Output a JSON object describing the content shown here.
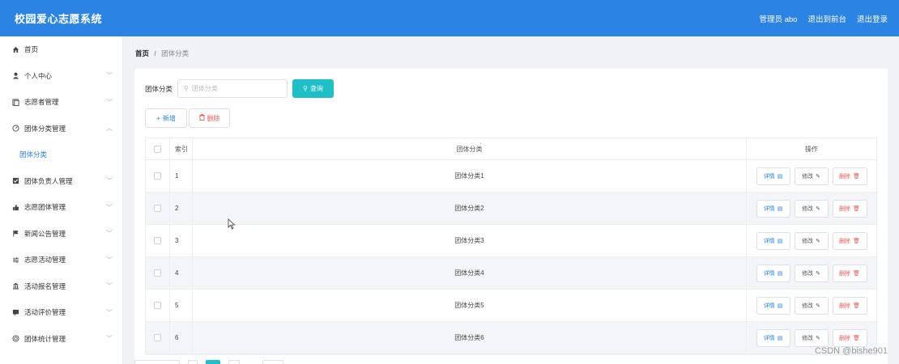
{
  "header": {
    "app_title": "校园爱心志愿系统",
    "admin_label": "管理员 abo",
    "back_to_front": "退出到前台",
    "logout": "退出登录"
  },
  "sidebar": {
    "items": [
      {
        "label": "首页",
        "icon": "home-icon",
        "chevron": false
      },
      {
        "label": "个人中心",
        "icon": "user-icon",
        "chevron": true
      },
      {
        "label": "志愿者管理",
        "icon": "document-icon",
        "chevron": true
      },
      {
        "label": "团体分类管理",
        "icon": "gauge-icon",
        "chevron": true,
        "expanded": true
      },
      {
        "label": "团体负责人管理",
        "icon": "checkbox-icon",
        "chevron": true
      },
      {
        "label": "志愿团体管理",
        "icon": "thumbs-up-icon",
        "chevron": true
      },
      {
        "label": "新闻公告管理",
        "icon": "flag-icon",
        "chevron": true
      },
      {
        "label": "志愿活动管理",
        "icon": "sliders-icon",
        "chevron": true
      },
      {
        "label": "活动报名管理",
        "icon": "bank-icon",
        "chevron": true
      },
      {
        "label": "活动评价管理",
        "icon": "comment-icon",
        "chevron": true
      },
      {
        "label": "团体统计管理",
        "icon": "target-icon",
        "chevron": true
      }
    ],
    "sub_item": "团体分类"
  },
  "breadcrumb": {
    "home": "首页",
    "sep": "/",
    "current": "团体分类"
  },
  "search": {
    "label": "团体分类",
    "placeholder": "团体分类",
    "button": "查询"
  },
  "actions": {
    "add": "新增",
    "delete": "删除"
  },
  "table": {
    "headers": {
      "index": "索引",
      "name": "团体分类",
      "ops": "操作"
    },
    "rows": [
      {
        "index": "1",
        "name": "团体分类1"
      },
      {
        "index": "2",
        "name": "团体分类2"
      },
      {
        "index": "3",
        "name": "团体分类3"
      },
      {
        "index": "4",
        "name": "团体分类4"
      },
      {
        "index": "5",
        "name": "团体分类5"
      },
      {
        "index": "6",
        "name": "团体分类6"
      }
    ],
    "op_detail": "详情",
    "op_edit": "修改",
    "op_delete": "删除"
  },
  "watermark": "CSDN @bishe901",
  "colors": {
    "primary": "#2b83e3",
    "teal": "#1fbfc7",
    "danger": "#e55a5a"
  }
}
